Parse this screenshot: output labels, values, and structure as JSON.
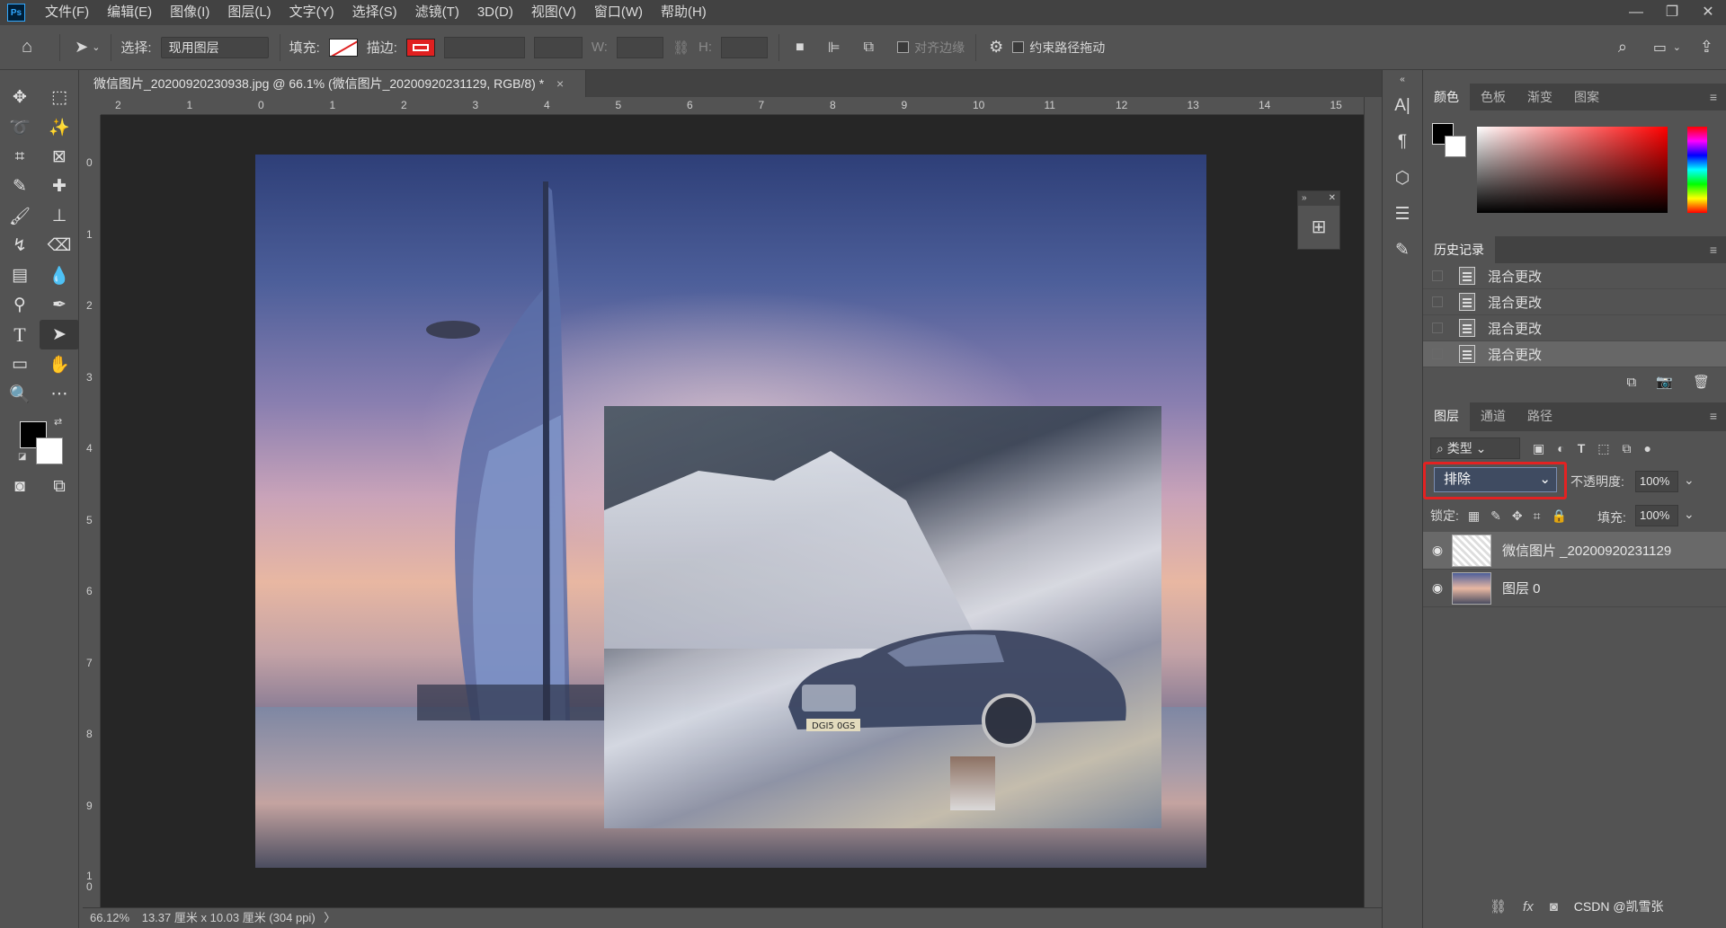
{
  "app": {
    "logo": "Ps"
  },
  "menu": [
    "文件(F)",
    "编辑(E)",
    "图像(I)",
    "图层(L)",
    "文字(Y)",
    "选择(S)",
    "滤镜(T)",
    "3D(D)",
    "视图(V)",
    "窗口(W)",
    "帮助(H)"
  ],
  "options": {
    "select_label": "选择:",
    "select_value": "现用图层",
    "fill_label": "填充:",
    "stroke_label": "描边:",
    "w_label": "W:",
    "h_label": "H:",
    "align_edges": "对齐边缘",
    "constrain_path": "约束路径拖动"
  },
  "document": {
    "tab_title": "微信图片_20200920230938.jpg @ 66.1% (微信图片_20200920231129, RGB/8) *",
    "close": "×"
  },
  "rulers": {
    "top": [
      "2",
      "1",
      "0",
      "1",
      "2",
      "3",
      "4",
      "5",
      "6",
      "7",
      "8",
      "9",
      "10",
      "11",
      "12",
      "13",
      "14",
      "15"
    ],
    "left": [
      "0",
      "1",
      "2",
      "3",
      "4",
      "5",
      "6",
      "7",
      "8",
      "9",
      "1 0"
    ]
  },
  "artwork": {
    "plate": "DGI5 0GS"
  },
  "status": {
    "zoom": "66.12%",
    "info": "13.37 厘米 x 10.03 厘米 (304 ppi)"
  },
  "panels": {
    "color_tabs": [
      "颜色",
      "色板",
      "渐变",
      "图案"
    ],
    "history_tab": "历史记录",
    "history_items": [
      "混合更改",
      "混合更改",
      "混合更改",
      "混合更改"
    ],
    "layers_tabs": [
      "图层",
      "通道",
      "路径"
    ],
    "filter_kind": "类型",
    "blend_mode": "排除",
    "opacity_label": "不透明度:",
    "opacity_value": "100%",
    "lock_label": "锁定:",
    "fill_label": "填充:",
    "fill_value": "100%",
    "layers": [
      {
        "name": "微信图片 _20200920231129"
      },
      {
        "name": "图层 0"
      }
    ],
    "watermark": "CSDN @凯雪张"
  },
  "colors": {
    "accent_red": "#e32222",
    "selection_blue": "#3f4b61"
  }
}
